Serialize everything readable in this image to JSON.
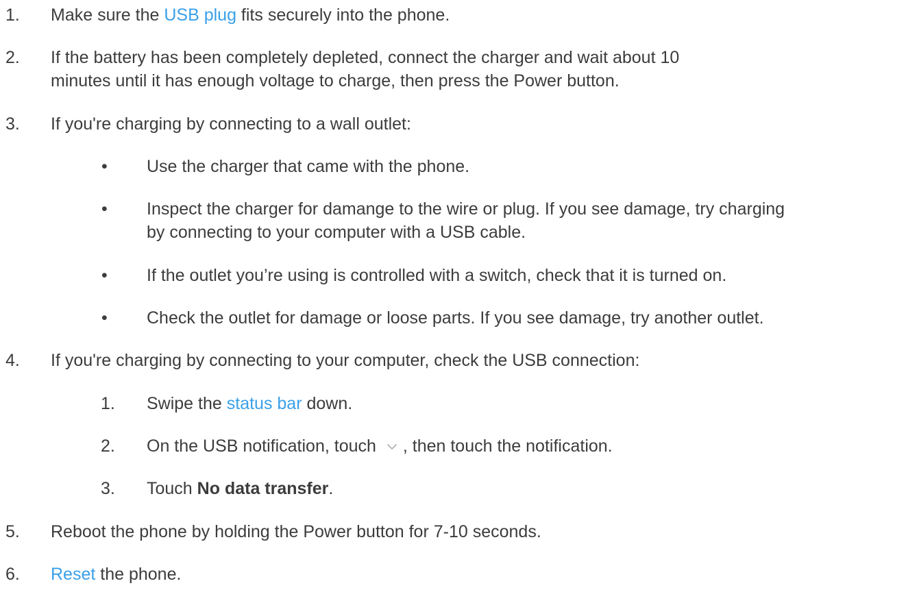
{
  "steps": [
    {
      "number": "1.",
      "before": "Make sure the ",
      "link": "USB plug",
      "after": " fits securely into the phone."
    },
    {
      "number": "2.",
      "line1": "If the battery has been completely depleted, connect the charger and wait about 10",
      "line2": "minutes until it has enough voltage to charge, then press the Power button."
    },
    {
      "number": "3.",
      "text": "If you're charging by connecting to a wall outlet:",
      "bullets": [
        {
          "marker": "•",
          "text": "Use the charger that came with the phone."
        },
        {
          "marker": "•",
          "line1": "Inspect the charger for damange to the wire or plug. If you see damage, try charging",
          "line2": "by connecting to your computer with a USB cable."
        },
        {
          "marker": "•",
          "text": "If the outlet you’re using is controlled with a switch, check that it is turned on."
        },
        {
          "marker": "•",
          "text": "Check the outlet for damage or loose parts. If you see damage, try another outlet."
        }
      ]
    },
    {
      "number": "4.",
      "text": "If you're charging by connecting to your computer, check the USB connection:",
      "substeps": [
        {
          "number": "1.",
          "before": "Swipe the ",
          "link": "status bar",
          "after": " down."
        },
        {
          "number": "2.",
          "before": "On the USB notification, touch ",
          "icon": "chevron-down-icon",
          "after": ", then touch the notification."
        },
        {
          "number": "3.",
          "before": "Touch ",
          "bold": "No data transfer",
          "after": "."
        }
      ]
    },
    {
      "number": "5.",
      "text": "Reboot the phone by holding the Power button for 7-10 seconds."
    },
    {
      "number": "6.",
      "link": "Reset",
      "after": " the phone."
    }
  ],
  "colors": {
    "text": "#3c3c3c",
    "link": "#3aa0e8",
    "icon": "#b4b4b4"
  }
}
